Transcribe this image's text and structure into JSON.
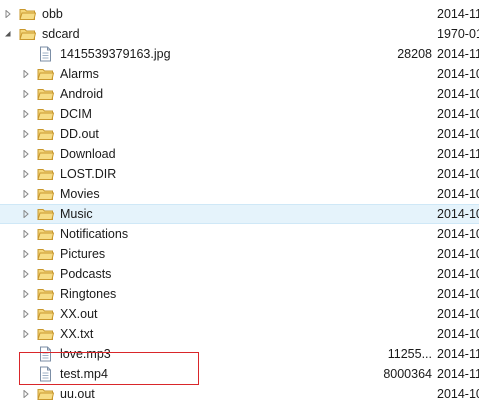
{
  "accent": {
    "selection": "#e5f3fb",
    "highlight": "#d9262a",
    "folder": "#e8b84a"
  },
  "rows": [
    {
      "name": "obb",
      "date": "2014-11",
      "size": "",
      "kind": "folder",
      "arrow": "collapsed",
      "level": 0
    },
    {
      "name": "sdcard",
      "date": "1970-01",
      "size": "",
      "kind": "folder",
      "arrow": "expanded",
      "level": 0
    },
    {
      "name": "1415539379163.jpg",
      "date": "2014-11",
      "size": "28208",
      "kind": "file",
      "arrow": "none",
      "level": 1
    },
    {
      "name": "Alarms",
      "date": "2014-10",
      "size": "",
      "kind": "folder",
      "arrow": "collapsed",
      "level": 1
    },
    {
      "name": "Android",
      "date": "2014-10",
      "size": "",
      "kind": "folder",
      "arrow": "collapsed",
      "level": 1
    },
    {
      "name": "DCIM",
      "date": "2014-10",
      "size": "",
      "kind": "folder",
      "arrow": "collapsed",
      "level": 1
    },
    {
      "name": "DD.out",
      "date": "2014-10",
      "size": "",
      "kind": "folder",
      "arrow": "collapsed",
      "level": 1
    },
    {
      "name": "Download",
      "date": "2014-11",
      "size": "",
      "kind": "folder",
      "arrow": "collapsed",
      "level": 1
    },
    {
      "name": "LOST.DIR",
      "date": "2014-10",
      "size": "",
      "kind": "folder",
      "arrow": "collapsed",
      "level": 1
    },
    {
      "name": "Movies",
      "date": "2014-10",
      "size": "",
      "kind": "folder",
      "arrow": "collapsed",
      "level": 1
    },
    {
      "name": "Music",
      "date": "2014-10",
      "size": "",
      "kind": "folder",
      "arrow": "collapsed",
      "level": 1,
      "selected": true
    },
    {
      "name": "Notifications",
      "date": "2014-10",
      "size": "",
      "kind": "folder",
      "arrow": "collapsed",
      "level": 1
    },
    {
      "name": "Pictures",
      "date": "2014-10",
      "size": "",
      "kind": "folder",
      "arrow": "collapsed",
      "level": 1
    },
    {
      "name": "Podcasts",
      "date": "2014-10",
      "size": "",
      "kind": "folder",
      "arrow": "collapsed",
      "level": 1
    },
    {
      "name": "Ringtones",
      "date": "2014-10",
      "size": "",
      "kind": "folder",
      "arrow": "collapsed",
      "level": 1
    },
    {
      "name": "XX.out",
      "date": "2014-10",
      "size": "",
      "kind": "folder",
      "arrow": "collapsed",
      "level": 1
    },
    {
      "name": "XX.txt",
      "date": "2014-10",
      "size": "",
      "kind": "folder",
      "arrow": "collapsed",
      "level": 1
    },
    {
      "name": "love.mp3",
      "date": "2014-11",
      "size": "11255...",
      "kind": "file",
      "arrow": "none",
      "level": 1
    },
    {
      "name": "test.mp4",
      "date": "2014-11",
      "size": "8000364",
      "kind": "file",
      "arrow": "none",
      "level": 1
    },
    {
      "name": "uu.out",
      "date": "2014-10",
      "size": "",
      "kind": "folder",
      "arrow": "collapsed",
      "level": 1
    }
  ]
}
